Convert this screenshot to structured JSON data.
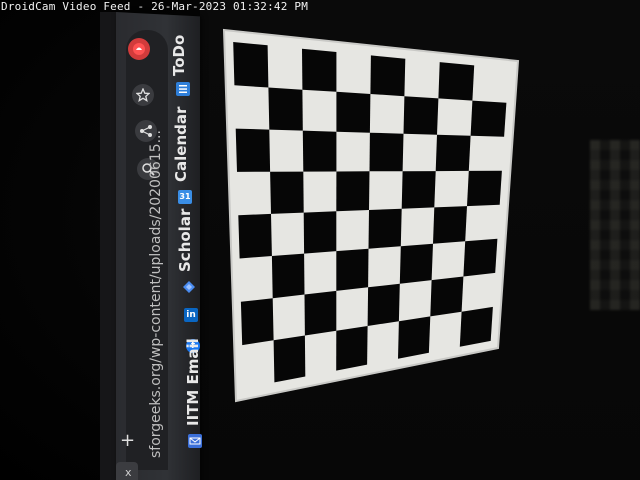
{
  "feed": {
    "title": "DroidCam Video Feed",
    "timestamp": "26-Mar-2023 01:32:42 PM",
    "header_text": "DroidCam Video Feed - 26-Mar-2023 01:32:42 PM"
  },
  "browser": {
    "url_text": "sforgeeks.org/wp-content/uploads/20200615...",
    "new_tab_label": "+",
    "close_tab_label": "x",
    "toolbar_icons": [
      "profile-icon",
      "star-icon",
      "share-icon",
      "zoom-icon"
    ],
    "bookmarks": [
      {
        "label": "ToDo",
        "icon": "todo-icon",
        "icon_color": "#2f7fd9"
      },
      {
        "label": "Calendar",
        "icon": "calendar-icon",
        "icon_color": "#3a8ee6"
      },
      {
        "label": "Scholar",
        "icon": "scholar-icon",
        "icon_color": "#4a8cf0"
      },
      {
        "label": "",
        "icon": "linkedin-icon",
        "icon_color": "#0a66c2"
      },
      {
        "label": "",
        "icon": "facebook-icon",
        "icon_color": "#1877f2"
      },
      {
        "label": "IITM Email",
        "icon": "email-icon",
        "icon_color": "#3b6fd8"
      }
    ],
    "linkedin_glyph": "in",
    "facebook_glyph": "f",
    "calendar_glyph": "31"
  },
  "scene": {
    "chessboard": {
      "rows": 8,
      "cols": 8
    },
    "colors": {
      "dark_square": "#060606",
      "light_square": "#e6e6e2",
      "border": "#c9c9c6"
    }
  }
}
